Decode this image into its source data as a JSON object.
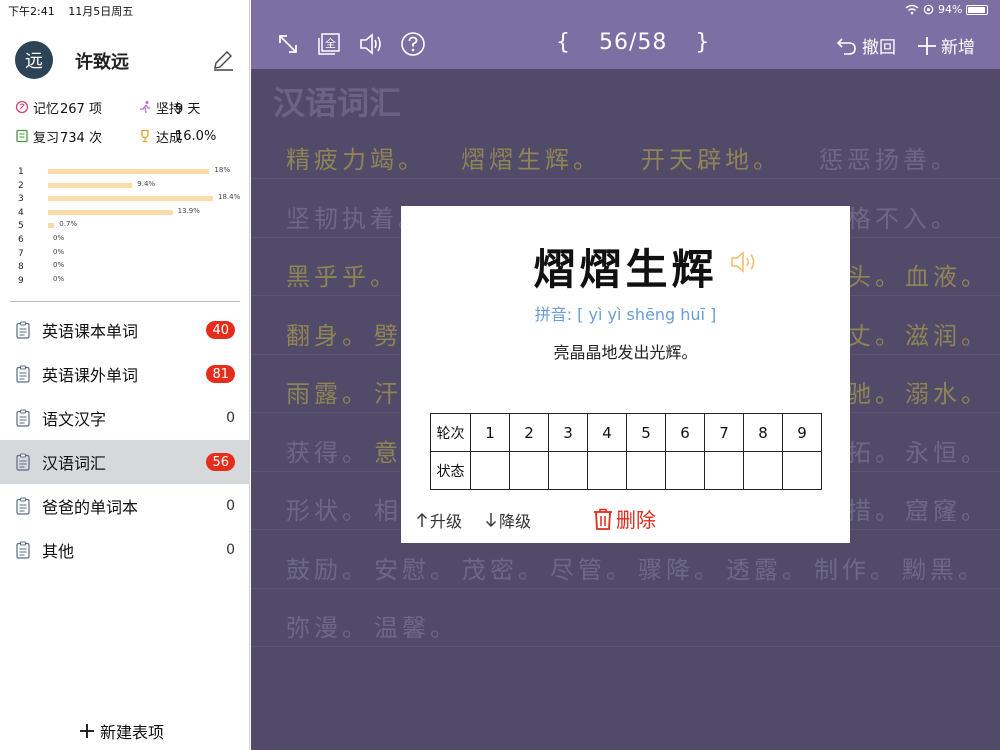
{
  "status": {
    "time": "下午2:41",
    "date": "11月5日周五",
    "battery": "94%"
  },
  "user": {
    "avatar": "远",
    "name": "许致远"
  },
  "stats": {
    "memory_label": "记忆",
    "memory_value": "267 项",
    "persist_label": "坚持",
    "persist_value": "9 天",
    "review_label": "复习",
    "review_value": "734 次",
    "achieve_label": "达成",
    "achieve_value": "16.0%"
  },
  "progress": [
    {
      "round": "1",
      "pct": "18%",
      "value": 18
    },
    {
      "round": "2",
      "pct": "9.4%",
      "value": 9.4
    },
    {
      "round": "3",
      "pct": "18.4%",
      "value": 18.4
    },
    {
      "round": "4",
      "pct": "13.9%",
      "value": 13.9
    },
    {
      "round": "5",
      "pct": "0.7%",
      "value": 0.7
    },
    {
      "round": "6",
      "pct": "0%",
      "value": 0
    },
    {
      "round": "7",
      "pct": "0%",
      "value": 0
    },
    {
      "round": "8",
      "pct": "0%",
      "value": 0
    },
    {
      "round": "9",
      "pct": "0%",
      "value": 0
    }
  ],
  "lists": [
    {
      "label": "英语课本单词",
      "count": "40",
      "badge": true
    },
    {
      "label": "英语课外单词",
      "count": "81",
      "badge": true
    },
    {
      "label": "语文汉字",
      "count": "0",
      "badge": false
    },
    {
      "label": "汉语词汇",
      "count": "56",
      "badge": true,
      "selected": true
    },
    {
      "label": "爸爸的单词本",
      "count": "0",
      "badge": false
    },
    {
      "label": "其他",
      "count": "0",
      "badge": false
    }
  ],
  "new_item_label": "新建表项",
  "toolbar": {
    "counter": "56/58",
    "brace_left": "{",
    "brace_right": "}",
    "undo_label": "撤回",
    "add_label": "新增",
    "full_glyph": "全"
  },
  "content": {
    "title": "汉语词汇",
    "rows": [
      [
        {
          "t": "精疲力竭。",
          "c": "y"
        },
        {
          "t": "熠熠生辉。",
          "c": "y"
        },
        {
          "t": "开天辟地。",
          "c": "y"
        },
        {
          "t": "惩恶扬善。",
          "c": "g"
        }
      ],
      [
        {
          "t": "坚韧执着。",
          "c": "g"
        },
        {
          "t": "",
          "c": "g"
        },
        {
          "t": "",
          "c": "g"
        },
        {
          "t": "格格不入。",
          "c": "g"
        }
      ],
      [
        {
          "t": "黑乎乎。",
          "c": "y"
        },
        {
          "t": "",
          "c": "y"
        },
        {
          "t": "",
          "c": "y"
        },
        {
          "t": "头。",
          "c": "y"
        },
        {
          "t": "血液。",
          "c": "y"
        }
      ],
      [
        {
          "t": "翻身。",
          "c": "y"
        },
        {
          "t": "劈",
          "c": "y"
        },
        {
          "t": "",
          "c": "y"
        },
        {
          "t": "丈。",
          "c": "y"
        },
        {
          "t": "滋润。",
          "c": "y"
        }
      ],
      [
        {
          "t": "雨露。",
          "c": "y"
        },
        {
          "t": "汗",
          "c": "y"
        },
        {
          "t": "",
          "c": "y"
        },
        {
          "t": "驰。",
          "c": "y"
        },
        {
          "t": "溺水。",
          "c": "y"
        }
      ],
      [
        {
          "t": "获得。",
          "c": "g"
        },
        {
          "t": "意",
          "c": "y"
        },
        {
          "t": "",
          "c": "g"
        },
        {
          "t": "拓。",
          "c": "g"
        },
        {
          "t": "永恒。",
          "c": "g"
        }
      ],
      [
        {
          "t": "形状。",
          "c": "g"
        },
        {
          "t": "相",
          "c": "g"
        },
        {
          "t": "",
          "c": "g"
        },
        {
          "t": "措。",
          "c": "g"
        },
        {
          "t": "窟窿。",
          "c": "g"
        }
      ],
      [
        {
          "t": "鼓励。",
          "c": "g"
        },
        {
          "t": "安慰。",
          "c": "g"
        },
        {
          "t": "茂密。",
          "c": "g"
        },
        {
          "t": "尽管。",
          "c": "g"
        },
        {
          "t": "骤降。",
          "c": "g"
        },
        {
          "t": "透露。",
          "c": "g"
        },
        {
          "t": "制作。",
          "c": "g"
        },
        {
          "t": "黝黑。",
          "c": "g"
        }
      ],
      [
        {
          "t": "弥漫。",
          "c": "g"
        },
        {
          "t": "温馨。",
          "c": "g"
        }
      ]
    ]
  },
  "card": {
    "word": "熠熠生辉",
    "pinyin": "拼音: [ yì yì shēng huī ]",
    "meaning": "亮晶晶地发出光辉。",
    "round_label": "轮次",
    "status_label": "状态",
    "rounds": [
      "1",
      "2",
      "3",
      "4",
      "5",
      "6",
      "7",
      "8",
      "9"
    ],
    "upgrade_label": "升级",
    "downgrade_label": "降级",
    "delete_label": "删除"
  },
  "colors": {
    "toolbar": "#7c6fa3",
    "main_bg": "#514b69",
    "badge": "#e52d1c",
    "delete": "#e02a1a",
    "pinyin": "#6a9ed6",
    "bar": "#f9dcaa"
  }
}
